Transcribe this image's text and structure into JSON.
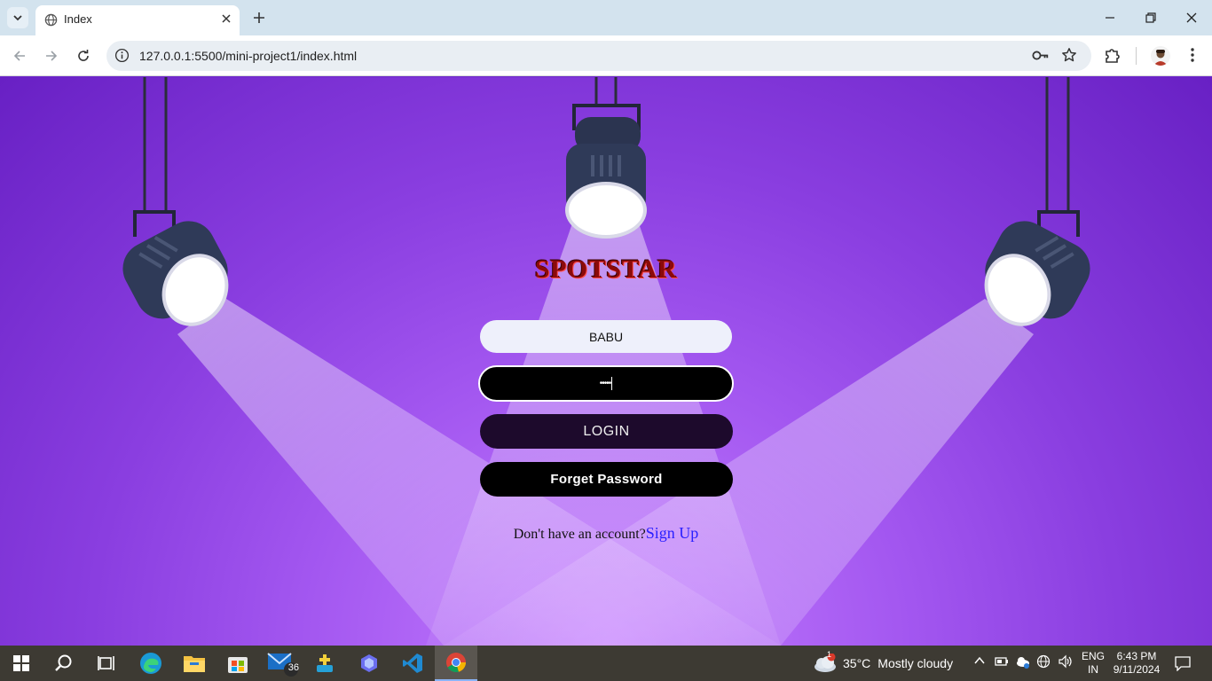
{
  "browser": {
    "tab_title": "Index",
    "url": "127.0.0.1:5500/mini-project1/index.html"
  },
  "page": {
    "brand": "SPOTSTAR",
    "username_value": "BABU",
    "password_mask": "•••••",
    "login_label": "LOGIN",
    "forget_label": "Forget Password",
    "signup_prompt": "Don't have an account?",
    "signup_link": "Sign Up"
  },
  "taskbar": {
    "mail_badge": "36",
    "weather_alert": "1",
    "temperature": "35°C",
    "condition": "Mostly cloudy",
    "lang_line1": "ENG",
    "lang_line2": "IN",
    "time": "6:43 PM",
    "date": "9/11/2024"
  },
  "colors": {
    "page_bg": "#8a3ee0",
    "brand": "#8b0a0a",
    "link": "#2a20ff"
  }
}
